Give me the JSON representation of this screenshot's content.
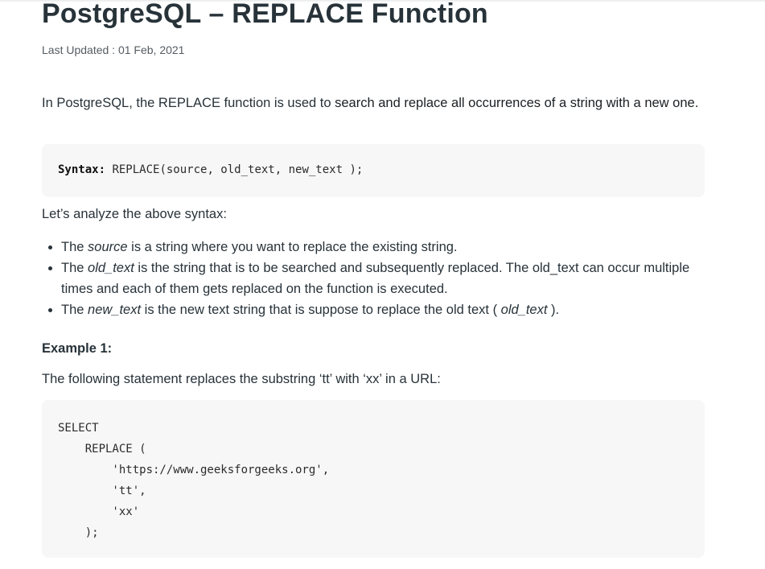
{
  "article": {
    "title": "PostgreSQL – REPLACE Function",
    "last_updated": "Last Updated : 01 Feb, 2021",
    "intro_part1": "In PostgreSQL, the REPLACE function is used to ",
    "intro_part2": "search and replace all occurrences of a string with a new one.",
    "syntax_label": "Syntax:",
    "syntax_text": " REPLACE(source, old_text, new_text );",
    "analyze_text": "Let’s analyze the above syntax:",
    "points": [
      {
        "pre": "The ",
        "term": "source",
        "post": " is a string where you want to replace the existing string."
      },
      {
        "pre": "The ",
        "term": "old_text",
        "post": " is the string that is to be searched and subsequently replaced. The old_text can occur multiple times and each of them gets replaced on the function is executed."
      },
      {
        "pre": "The ",
        "term": "new_text",
        "post": " is the new text string that is suppose to replace the old text ( ",
        "term2": "old_text",
        "post2": " )."
      }
    ],
    "example_heading": "Example 1:",
    "example_statement": "The following statement replaces the substring ‘tt’ with ‘xx’ in a URL:",
    "code": "SELECT\n    REPLACE (\n        'https://www.geeksforgeeks.org',\n        'tt',\n        'xx'\n    );"
  }
}
